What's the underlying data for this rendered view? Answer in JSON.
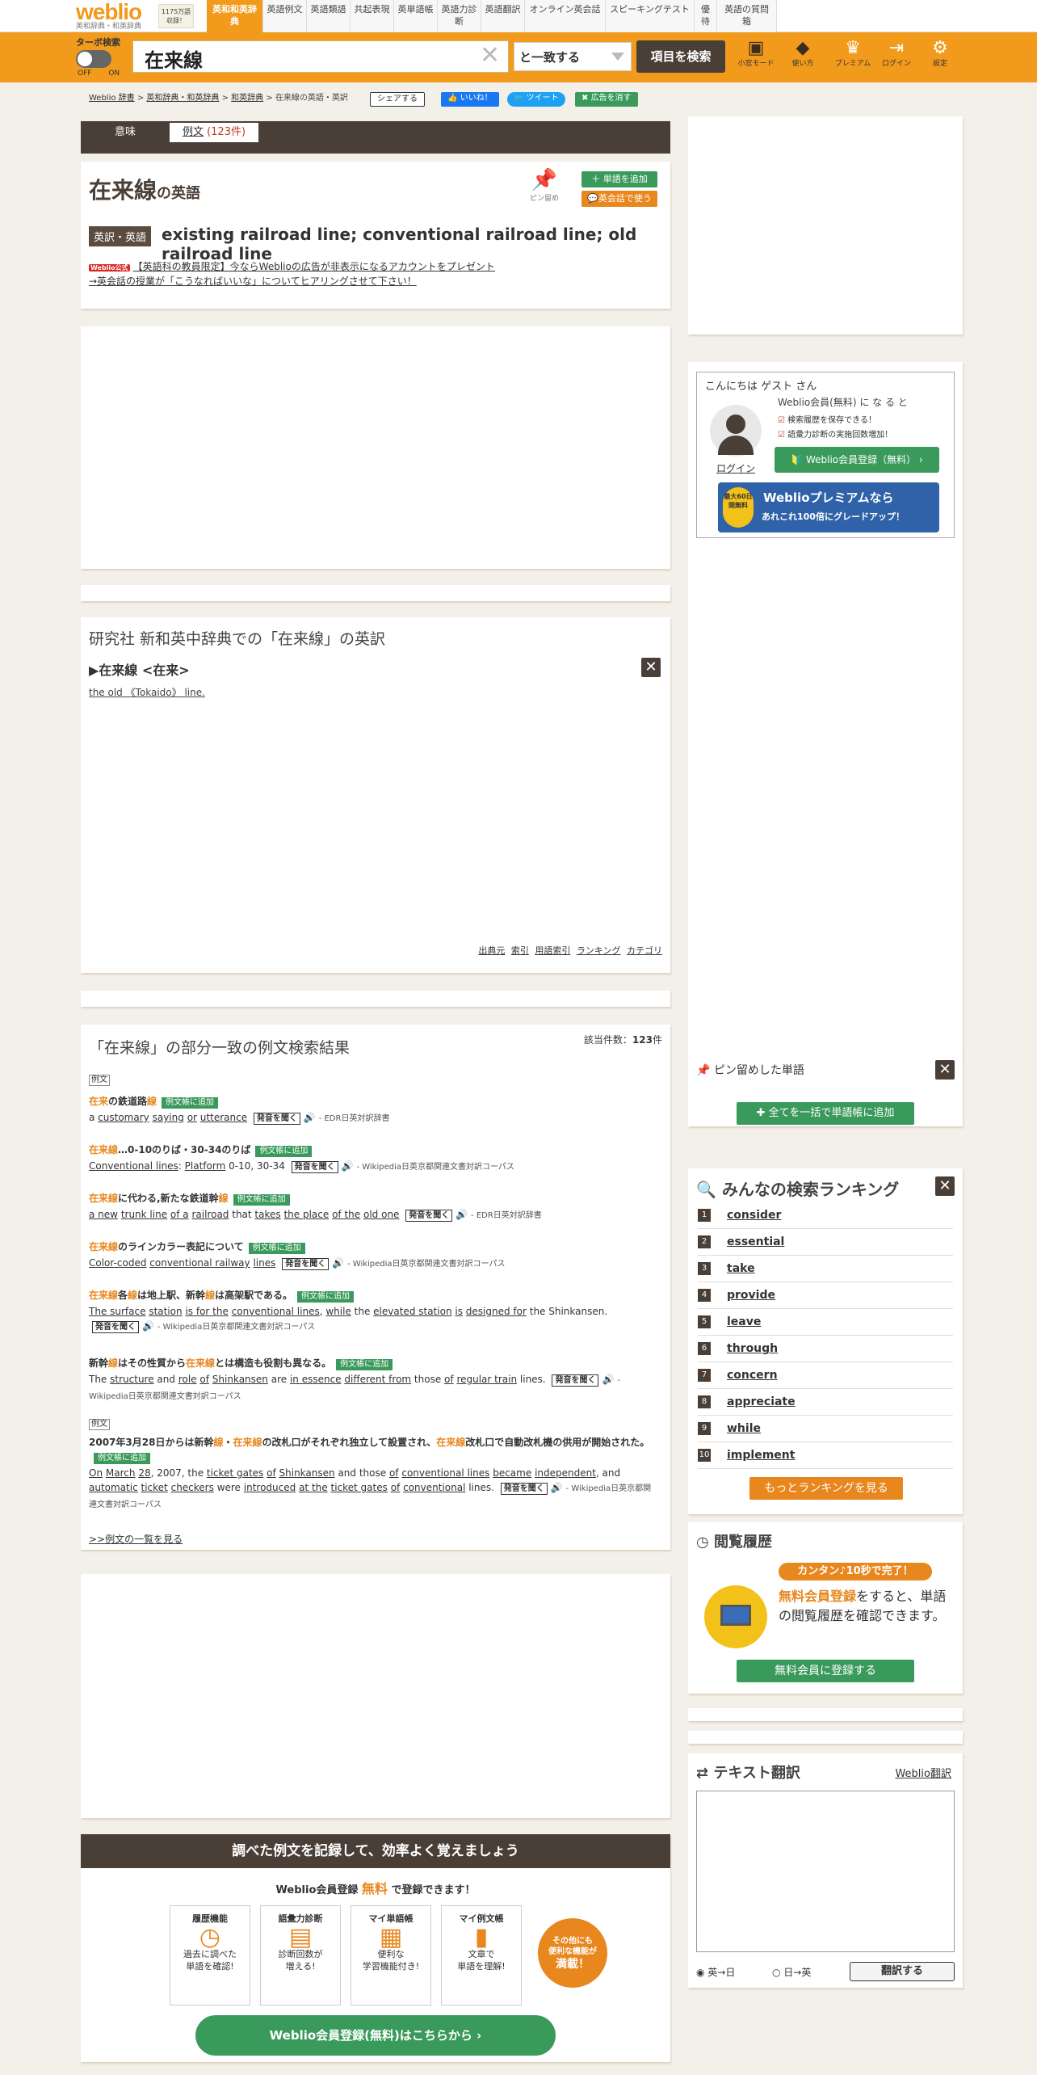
{
  "header": {
    "logo": "weblio",
    "logo_sub": "英和辞典・和英辞典",
    "count_line1": "1175万語",
    "count_line2": "収録！",
    "tabs": [
      "英和和英辞典",
      "英語例文",
      "英語類語",
      "共起表現",
      "英単語帳",
      "英語力診断",
      "英語翻訳",
      "オンライン英会話",
      "スピーキングテスト",
      "優待",
      "英語の質問箱"
    ],
    "active_tab": 0
  },
  "searchbar": {
    "turbo_label": "ターボ検索",
    "off": "OFF",
    "on": "ON",
    "query": "在来線",
    "mode": "と一致する",
    "go_label": "項目を検索",
    "icons": [
      {
        "name": "mobile-mode",
        "label": "小窓モード"
      },
      {
        "name": "howto",
        "label": "使い方"
      },
      {
        "name": "premium",
        "label": "プレミアム"
      },
      {
        "name": "login",
        "label": "ログイン"
      },
      {
        "name": "settings",
        "label": "設定"
      }
    ]
  },
  "breadcrumb": [
    "Weblio 辞書",
    "英和辞典・和英辞典",
    "和英辞典",
    "在来線の英語・英訳"
  ],
  "share": {
    "share": "シェアする",
    "like": "いいね！",
    "tweet": "ツイート",
    "ads": "広告を消す"
  },
  "main_tabs": {
    "meaning": "意味",
    "examples": "例文",
    "examples_count": "(123件)"
  },
  "entry": {
    "word": "在来線",
    "suffix": "の英語",
    "pin_label": "ピン留め",
    "add_word": "単語を追加",
    "use_in_conversation": "英会話で使う",
    "label": "英訳・英語",
    "definition": "existing railroad line; conventional railroad line; old railroad line",
    "promo_badge": "Weblio公式",
    "promo_line1": "【英語科の教員限定】今ならWeblioの広告が非表示になるアカウントをプレゼント",
    "promo_line2": "→英会話の授業が「こうなればいいな」についてヒアリングさせて下さい！"
  },
  "kenkyusha": {
    "title": "研究社 新和英中辞典での「在来線」の英訳",
    "headword": "▶在来線 <在来>",
    "example": "the old 《Tokaido》 line.",
    "footer_links": [
      "出典元",
      "索引",
      "用語索引",
      "ランキング",
      "カテゴリ"
    ]
  },
  "examples_section": {
    "title": "「在来線」の部分一致の例文検索結果",
    "count_label": "該当件数：",
    "count": "123",
    "count_unit": "件",
    "reibun": "例文",
    "add_label": "例文帳に追加",
    "hear_label": "発音を聞く",
    "items": [
      {
        "jp": "在来の鉄道路線",
        "en": "a customary saying or utterance",
        "src": "- EDR日英対訳辞書"
      },
      {
        "jp": "在来線…0-10のりば・30-34のりば",
        "en": "Conventional lines: Platform 0-10, 30-34",
        "src": "- Wikipedia日英京都関連文書対訳コーパス"
      },
      {
        "jp": "在来線に代わる,新たな鉄道幹線",
        "en": "a new trunk line of a railroad that takes the place of the old one",
        "src": "- EDR日英対訳辞書"
      },
      {
        "jp": "在来線のラインカラー表記について",
        "en": "Color-coded conventional railway lines",
        "src": "- Wikipedia日英京都関連文書対訳コーパス"
      },
      {
        "jp": "在来線各線は地上駅、新幹線は高架駅である。",
        "en": "The surface station is for the conventional lines, while the elevated station is designed for the Shinkansen.",
        "src": "- Wikipedia日英京都関連文書対訳コーパス"
      },
      {
        "jp": "新幹線はその性質から在来線とは構造も役割も異なる。",
        "en": "The structure and role of Shinkansen are in essence different from those of regular train lines.",
        "src": "- Wikipedia日英京都関連文書対訳コーパス"
      },
      {
        "jp": "2007年3月28日からは新幹線・在来線の改札口がそれぞれ独立して設置され、在来線改札口で自動改札機の供用が開始された。",
        "en": "On March 28, 2007, the ticket gates of Shinkansen and those of conventional lines became independent, and automatic ticket checkers were introduced at the ticket gates of conventional lines.",
        "src": "- Wikipedia日英京都関連文書対訳コーパス"
      }
    ],
    "more": ">>例文の一覧を見る"
  },
  "signup_banner": {
    "title": "調べた例文を記録して、効率よく覚えましょう",
    "sub_pre": "Weblio会員登録",
    "sub_free": "無料",
    "sub_post": "で登録できます！",
    "features": [
      {
        "title": "履歴機能",
        "desc1": "過去に調べた",
        "desc2": "単語を確認!",
        "icon": "clock-icon"
      },
      {
        "title": "語彙力診断",
        "desc1": "診断回数が",
        "desc2": "増える!",
        "icon": "clipboard-icon"
      },
      {
        "title": "マイ単語帳",
        "desc1": "便利な",
        "desc2": "学習機能付き!",
        "icon": "cards-icon"
      },
      {
        "title": "マイ例文帳",
        "desc1": "文章で",
        "desc2": "単語を理解!",
        "icon": "book-icon"
      }
    ],
    "other_line1": "その他にも",
    "other_line2": "便利な機能が",
    "other_line3": "満載！",
    "cta": "Weblio会員登録(無料)はこちらから"
  },
  "sidebar": {
    "greeting": "こんにちは ゲスト さん",
    "member_intro": "Weblio会員(無料) に な る と",
    "benefit1": "検索履歴を保存できる！",
    "benefit2": "語彙力診断の実施回数増加！",
    "login": "ログイン",
    "register": "Weblio会員登録（無料）",
    "premium_badge": "最大60日間無料",
    "premium_line1": "Weblioプレミアムなら",
    "premium_line2": "あれこれ100倍にグレードアップ！",
    "pinned_title": "ピン留めした単語",
    "add_all": "全てを一括で単語帳に追加",
    "ranking_title": "みんなの検索ランキング",
    "ranking": [
      "consider",
      "essential",
      "take",
      "provide",
      "leave",
      "through",
      "concern",
      "appreciate",
      "while",
      "implement"
    ],
    "ranking_more": "もっとランキングを見る",
    "history_title": "閲覧履歴",
    "history_badge": "カンタン♪10秒で完了！",
    "history_desc_em": "無料会員登録",
    "history_desc": "をすると、単語の閲覧履歴を確認できます。",
    "history_btn": "無料会員に登録する",
    "translate_title": "テキスト翻訳",
    "translate_link": "Weblio翻訳",
    "radio_ej": "英→日",
    "radio_je": "日→英",
    "translate_btn": "翻訳する"
  },
  "colors": {
    "orange": "#f29a1b",
    "brown": "#4a3f37",
    "green": "#3a9a5b"
  }
}
